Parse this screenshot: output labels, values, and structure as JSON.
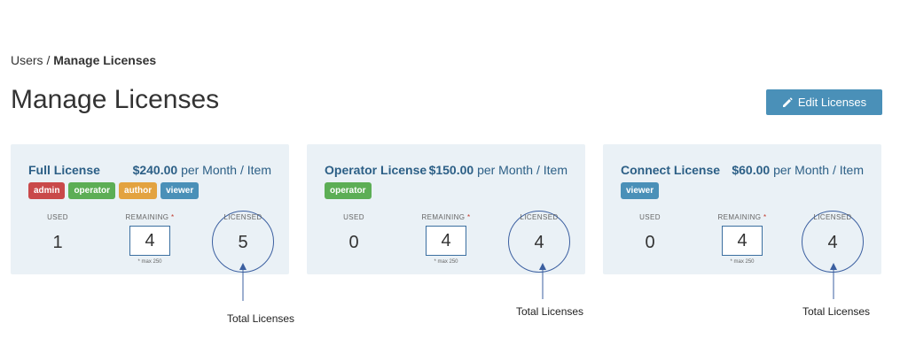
{
  "breadcrumb": {
    "parent": "Users",
    "separator": " / ",
    "current": "Manage Licenses"
  },
  "page_title": "Manage Licenses",
  "edit_button": {
    "label": "Edit Licenses",
    "icon": "pencil-icon",
    "color": "#4a90b8"
  },
  "stat_labels": {
    "used": "USED",
    "remaining": "REMAINING",
    "required_mark": "*",
    "licensed": "LICENSED"
  },
  "cards": [
    {
      "name": "Full License",
      "price_amount": "$240.00",
      "price_unit": "per Month / Item",
      "tags": [
        {
          "label": "admin",
          "color": "#c9494a"
        },
        {
          "label": "operator",
          "color": "#5cae55"
        },
        {
          "label": "author",
          "color": "#e3a340"
        },
        {
          "label": "viewer",
          "color": "#4a90b8"
        }
      ],
      "used": "1",
      "remaining": "4",
      "remaining_note": "* max 250",
      "licensed": "5"
    },
    {
      "name": "Operator License",
      "price_amount": "$150.00",
      "price_unit": "per Month / Item",
      "tags": [
        {
          "label": "operator",
          "color": "#5cae55"
        }
      ],
      "used": "0",
      "remaining": "4",
      "remaining_note": "* max 250",
      "licensed": "4"
    },
    {
      "name": "Connect License",
      "price_amount": "$60.00",
      "price_unit": "per Month / Item",
      "tags": [
        {
          "label": "viewer",
          "color": "#4a90b8"
        }
      ],
      "used": "0",
      "remaining": "4",
      "remaining_note": "* max 250",
      "licensed": "4"
    }
  ],
  "annotation_label": "Total Licenses",
  "colors": {
    "card_bg": "#eaf1f6",
    "title_blue": "#2c5f86",
    "circle": "#3b5fa0"
  }
}
